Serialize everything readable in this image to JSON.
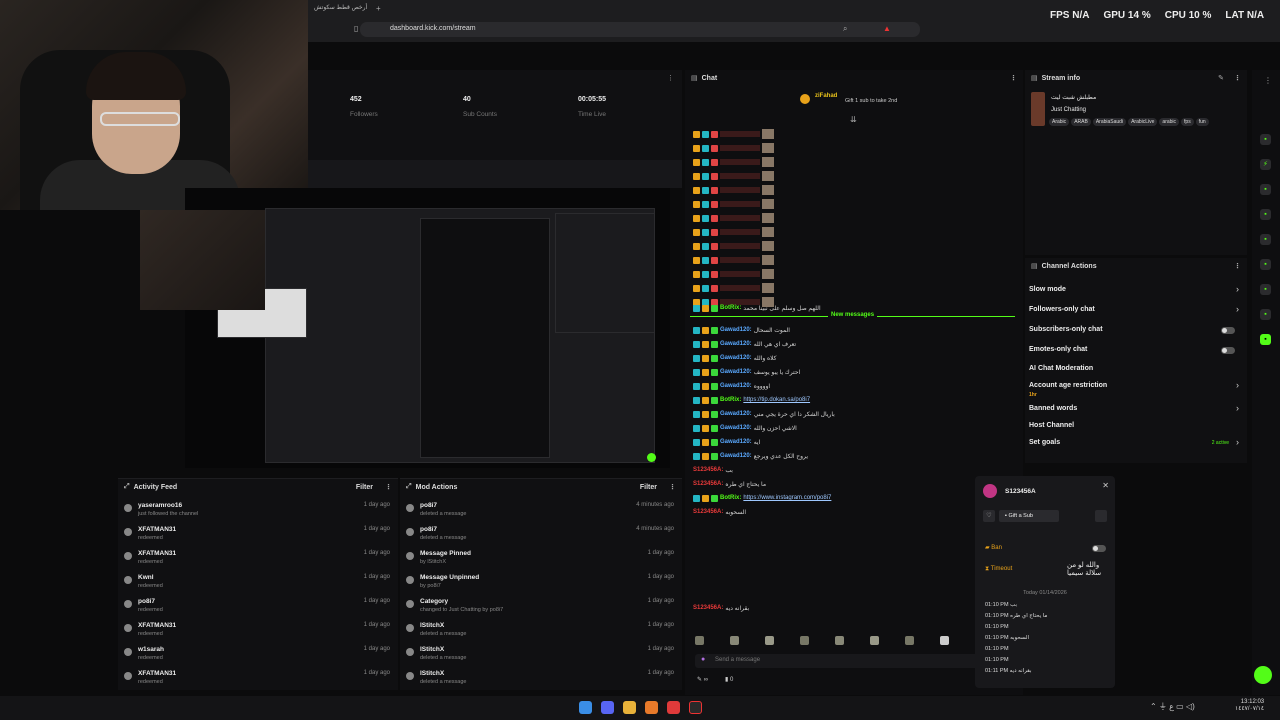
{
  "browser": {
    "tab_title": "أرخص قطط سكوتش",
    "url": "dashboard.kick.com/stream"
  },
  "perf": {
    "fps_label": "FPS",
    "fps_value": "N/A",
    "gpu_label": "GPU",
    "gpu_value": "14 %",
    "cpu_label": "CPU",
    "cpu_value": "10 %",
    "lat_label": "LAT",
    "lat_value": "N/A"
  },
  "stats": [
    {
      "value": "452",
      "label": "Followers"
    },
    {
      "value": "40",
      "label": "Sub Counts"
    },
    {
      "value": "00:05:55",
      "label": "Time Live"
    }
  ],
  "activity": {
    "title": "Activity Feed",
    "filter": "Filter",
    "rows": [
      {
        "name": "yaseramroo16",
        "sub": "just followed the channel",
        "date": "1 day ago"
      },
      {
        "name": "XFATMAN31",
        "sub": "redeemed",
        "date": "1 day ago"
      },
      {
        "name": "XFATMAN31",
        "sub": "redeemed",
        "date": "1 day ago"
      },
      {
        "name": "Kwnl",
        "sub": "redeemed",
        "date": "1 day ago"
      },
      {
        "name": "po8i7",
        "sub": "redeemed",
        "date": "1 day ago"
      },
      {
        "name": "XFATMAN31",
        "sub": "redeemed",
        "date": "1 day ago"
      },
      {
        "name": "w1sarah",
        "sub": "redeemed",
        "date": "1 day ago"
      },
      {
        "name": "XFATMAN31",
        "sub": "redeemed",
        "date": "1 day ago"
      }
    ]
  },
  "mod": {
    "title": "Mod Actions",
    "filter": "Filter",
    "rows": [
      {
        "name": "po8i7",
        "sub": "deleted a message",
        "date": "4 minutes ago"
      },
      {
        "name": "po8i7",
        "sub": "deleted a message",
        "date": "4 minutes ago"
      },
      {
        "name": "Message Pinned",
        "sub": "by lStitchX",
        "date": "1 day ago"
      },
      {
        "name": "Message Unpinned",
        "sub": "by po8i7",
        "date": "1 day ago"
      },
      {
        "name": "Category",
        "sub": "changed to Just Chatting by po8i7",
        "date": "1 day ago"
      },
      {
        "name": "lStitchX",
        "sub": "deleted a message",
        "date": "1 day ago"
      },
      {
        "name": "lStitchX",
        "sub": "deleted a message",
        "date": "1 day ago"
      },
      {
        "name": "lStitchX",
        "sub": "deleted a message",
        "date": "1 day ago"
      }
    ]
  },
  "chat": {
    "title": "Chat",
    "gifter": "ziFahad",
    "gift_text": "Gift 1 sub to take 2nd",
    "new_messages": "New messages",
    "input_placeholder": "Send a message",
    "count": "0",
    "lines": [
      {
        "user": "BotRix:",
        "text": "اللهم صل وسلم على نبينا محمد",
        "c": "grn"
      },
      {
        "user": "Gawad120:",
        "text": "الموت السحال",
        "c": "blu"
      },
      {
        "user": "Gawad120:",
        "text": "تعرف اي هي الله",
        "c": "blu"
      },
      {
        "user": "Gawad120:",
        "text": "كلاه والله",
        "c": "blu"
      },
      {
        "user": "Gawad120:",
        "text": "احترك يا يبو يوسف",
        "c": "blu"
      },
      {
        "user": "Gawad120:",
        "text": "اووووه",
        "c": "blu"
      },
      {
        "user": "BotRix:",
        "text": "https://tip.dokan.sa/po8i7",
        "c": "grn",
        "link": true
      },
      {
        "user": "Gawad120:",
        "text": "باريال الشكر دا اي حرة يجي مني",
        "c": "blu"
      },
      {
        "user": "Gawad120:",
        "text": "الاشي احزن والله",
        "c": "blu"
      },
      {
        "user": "Gawad120:",
        "text": "ايه",
        "c": "blu"
      },
      {
        "user": "Gawad120:",
        "text": "يروح الكل عدي ويرجع",
        "c": "blu"
      },
      {
        "user": "S123456A:",
        "text": "بب",
        "c": "red"
      },
      {
        "user": "S123456A:",
        "text": "ما يحتاج اي طره",
        "c": "red"
      },
      {
        "user": "BotRix:",
        "text": "https://www.instagram.com/po8i7",
        "c": "grn",
        "link": true
      },
      {
        "user": "S123456A:",
        "text": "السحوبه",
        "c": "red"
      },
      {
        "user": "S123456A:",
        "text": "بقرانه ديه",
        "c": "red"
      }
    ]
  },
  "stream_info": {
    "title": "Stream info",
    "stream_title": "مطبلش شبت ليت",
    "category": "Just Chatting",
    "tags": [
      "Arabic",
      "ARAB",
      "ArabiaSaudi",
      "ArabicLive",
      "arabic",
      "fps",
      "fun"
    ]
  },
  "channel_actions": {
    "title": "Channel Actions",
    "items": [
      "Slow mode",
      "Followers-only chat",
      "Subscribers-only chat",
      "Emotes-only chat",
      "AI Chat Moderation",
      "Account age restriction",
      "Banned words",
      "Host Channel",
      "Set goals"
    ],
    "age_sub": "1hr",
    "goals_sub": "2 active"
  },
  "user_popup": {
    "username": "S123456A",
    "gift_label": "Gift a Sub",
    "ban": "Ban",
    "timeout": "Timeout",
    "date": "Today 01/14/2026",
    "msgs": [
      {
        "time": "01:10 PM",
        "text": "بب"
      },
      {
        "time": "01:10 PM",
        "text": "ما يحتاج اي طره"
      },
      {
        "time": "01:10 PM",
        "text": ""
      },
      {
        "time": "01:10 PM",
        "text": "السحوبه"
      },
      {
        "time": "01:10 PM",
        "text": ""
      },
      {
        "time": "01:10 PM",
        "text": ""
      },
      {
        "time": "01:11 PM",
        "text": "بقرانه ديه"
      }
    ],
    "overlay_text": "والله لو من سلالة سيميا"
  },
  "clock": {
    "time": "13:12:03",
    "date": "١٤٤٧/٠٧/١٤"
  },
  "colors": {
    "kick_green": "#53fc18",
    "bg": "#0e0e10"
  }
}
